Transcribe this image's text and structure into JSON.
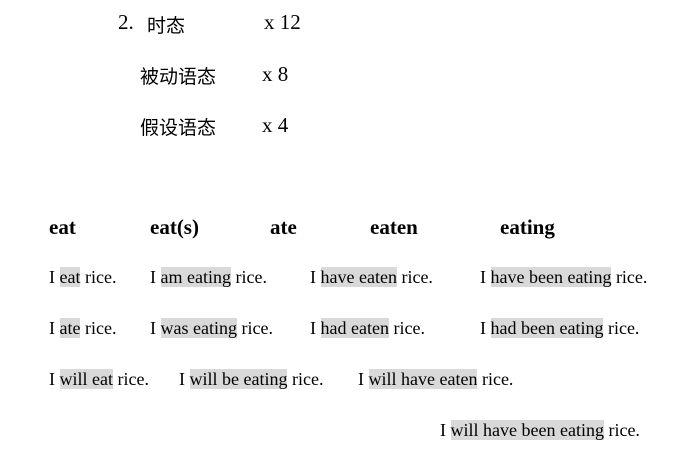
{
  "outline": {
    "number": "2.",
    "items": [
      {
        "label": "时态",
        "count": "x 12"
      },
      {
        "label": "被动语态",
        "count": "x 8"
      },
      {
        "label": "假设语态",
        "count": "x 4"
      }
    ]
  },
  "verb_forms": [
    "eat",
    "eat(s)",
    "ate",
    "eaten",
    "eating"
  ],
  "examples": {
    "present": [
      {
        "pre": "I ",
        "hl": "eat",
        "post": " rice."
      },
      {
        "pre": "I ",
        "hl": "am eating",
        "post": " rice."
      },
      {
        "pre": "I ",
        "hl": "have eaten",
        "post": " rice."
      },
      {
        "pre": "I ",
        "hl": "have been eating",
        "post": " rice."
      }
    ],
    "past": [
      {
        "pre": "I ",
        "hl": "ate",
        "post": " rice."
      },
      {
        "pre": "I ",
        "hl": "was eating",
        "post": " rice."
      },
      {
        "pre": "I ",
        "hl": "had eaten",
        "post": " rice."
      },
      {
        "pre": "I ",
        "hl": "had been eating",
        "post": " rice."
      }
    ],
    "future": [
      {
        "pre": "I ",
        "hl": "will eat",
        "post": " rice."
      },
      {
        "pre": "I ",
        "hl": "will be eating",
        "post": " rice."
      },
      {
        "pre": "I ",
        "hl": "will have eaten",
        "post": " rice."
      },
      {
        "pre": "I ",
        "hl": "will have been eating",
        "post": " rice."
      }
    ]
  },
  "colors": {
    "highlight": "#d9d9d9",
    "text": "#000000",
    "background": "#ffffff"
  }
}
